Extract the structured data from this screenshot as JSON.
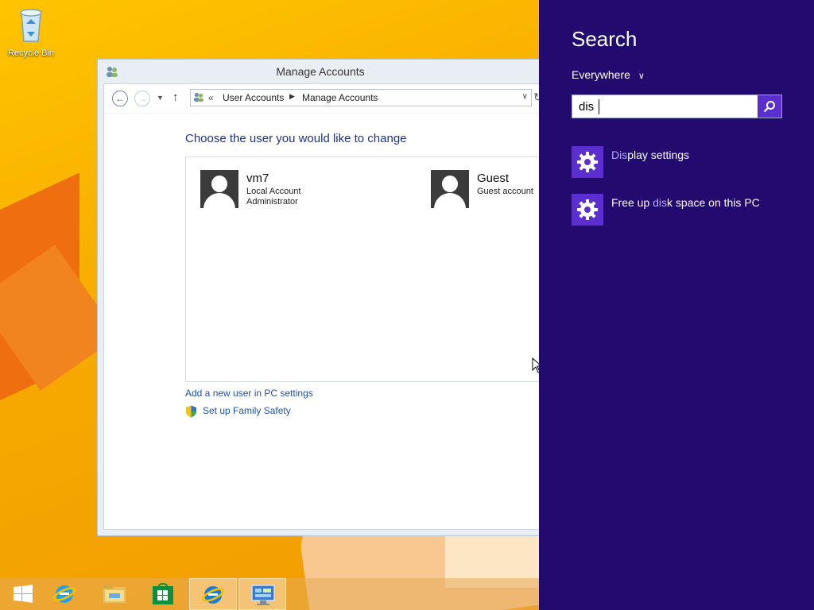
{
  "desktop": {
    "icons": [
      {
        "label": "Recycle Bin",
        "icon": "recycle-bin-icon"
      }
    ]
  },
  "window": {
    "title": "Manage Accounts",
    "address": {
      "chevron": "«",
      "crumbs": [
        "User Accounts",
        "Manage Accounts"
      ]
    },
    "heading": "Choose the user you would like to change",
    "accounts": [
      {
        "name": "vm7",
        "type": "Local Account",
        "role": "Administrator"
      },
      {
        "name": "Guest",
        "type": "Guest account",
        "role": ""
      }
    ],
    "links": {
      "add_user": "Add a new user in PC settings",
      "family_safety": "Set up Family Safety"
    }
  },
  "taskbar": {
    "items": [
      {
        "icon": "start-icon",
        "active": false
      },
      {
        "icon": "internet-explorer-icon",
        "active": false
      },
      {
        "icon": "file-explorer-icon",
        "active": false
      },
      {
        "icon": "store-icon",
        "active": false
      },
      {
        "icon": "internet-explorer-icon",
        "active": true
      },
      {
        "icon": "control-panel-icon",
        "active": true
      }
    ]
  },
  "charm": {
    "title": "Search",
    "scope": "Everywhere",
    "query": "dis",
    "results": [
      {
        "prefix": "",
        "match": "Dis",
        "suffix": "play settings",
        "icon": "gear-icon"
      },
      {
        "prefix": "Free up ",
        "match": "dis",
        "suffix": "k space on this PC",
        "icon": "gear-icon"
      }
    ]
  },
  "colors": {
    "charm_bg": "#220a6e",
    "charm_accent": "#5b2fcf",
    "link": "#1f4fb0",
    "heading": "#1e3287"
  }
}
